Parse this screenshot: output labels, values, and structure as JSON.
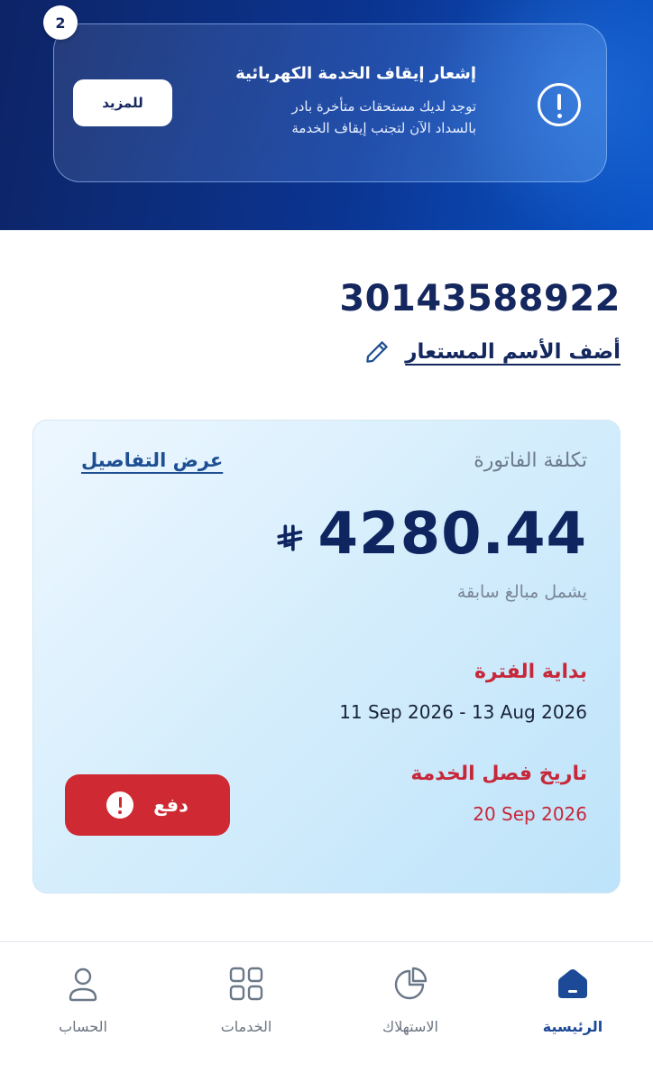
{
  "banner": {
    "page_count": "2",
    "title": "إشعار إيقاف الخدمة الكهربائية",
    "line1": "توجد لديك مستحقات متأخرة بادر",
    "line2": "بالسداد الآن لتجنب إيقاف الخدمة",
    "more_label": "للمزيد"
  },
  "account": {
    "number": "30143588922",
    "nickname_link": "أضف الأسم المستعار"
  },
  "bill": {
    "label": "تكلفة الفاتورة",
    "details_link": "عرض التفاصيل",
    "amount": "4280.44",
    "amount_note": "يشمل مبالغ سابقة",
    "period_label": "بداية الفترة",
    "period_value": "11 Sep 2026 - 13 Aug 2026",
    "disconnect_label": "تاريخ فصل الخدمة",
    "disconnect_date": "20 Sep 2026",
    "pay_label": "دفع"
  },
  "nav": {
    "items": [
      {
        "label": "الرئيسية",
        "icon": "home-icon",
        "active": true
      },
      {
        "label": "الاستهلاك",
        "icon": "pie-chart-icon",
        "active": false
      },
      {
        "label": "الخدمات",
        "icon": "grid-icon",
        "active": false
      },
      {
        "label": "الحساب",
        "icon": "user-icon",
        "active": false
      }
    ]
  },
  "colors": {
    "primary": "#14275e",
    "alert_red": "#cf2a33",
    "active_nav": "#1c4a96",
    "hero_start": "#0d2466",
    "hero_end": "#0a55c9"
  }
}
